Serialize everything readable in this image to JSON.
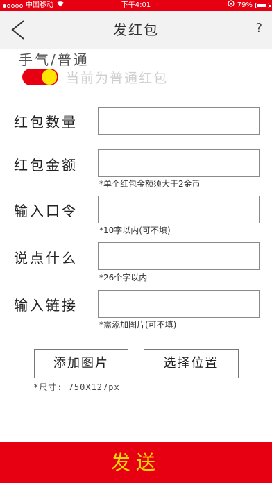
{
  "status_bar": {
    "carrier": "中国移动",
    "time": "下午4:01",
    "battery": "79%",
    "battery_level": 0.79
  },
  "nav": {
    "title": "发红包",
    "help": "?"
  },
  "mode": {
    "label": "手气/普通",
    "description": "当前为普通红包"
  },
  "fields": {
    "count_label": "红包数量",
    "amount_label": "红包金额",
    "amount_hint": "*单个红包金额须大于2金币",
    "password_label": "输入口令",
    "password_hint": "*10字以内(可不填)",
    "message_label": "说点什么",
    "message_hint": "*26个字以内",
    "link_label": "输入链接",
    "link_hint": "*需添加图片(可不填)"
  },
  "buttons": {
    "add_image": "添加图片",
    "choose_position": "选择位置",
    "size_note": "*尺寸: 750X127px",
    "send": "发送"
  },
  "colors": {
    "brand_red": "#e60012",
    "send_text_yellow": "#ffd900",
    "toggle_knob": "#ffe600"
  }
}
